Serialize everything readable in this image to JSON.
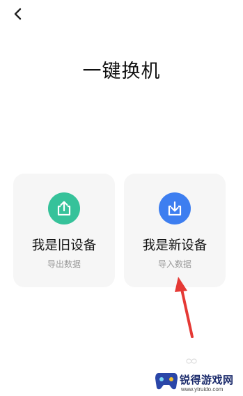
{
  "header": {
    "back_icon": "chevron-left-icon"
  },
  "page": {
    "title": "一键换机"
  },
  "cards": {
    "old": {
      "title": "我是旧设备",
      "subtitle": "导出数据",
      "icon": "upload-icon",
      "color": "#36c29a"
    },
    "new": {
      "title": "我是新设备",
      "subtitle": "导入数据",
      "icon": "download-icon",
      "color": "#3d7ef0"
    }
  },
  "watermark": {
    "name": "锐得游戏网",
    "url": "www.ytruido.com"
  },
  "annotation": {
    "arrow_color": "#e53935"
  }
}
